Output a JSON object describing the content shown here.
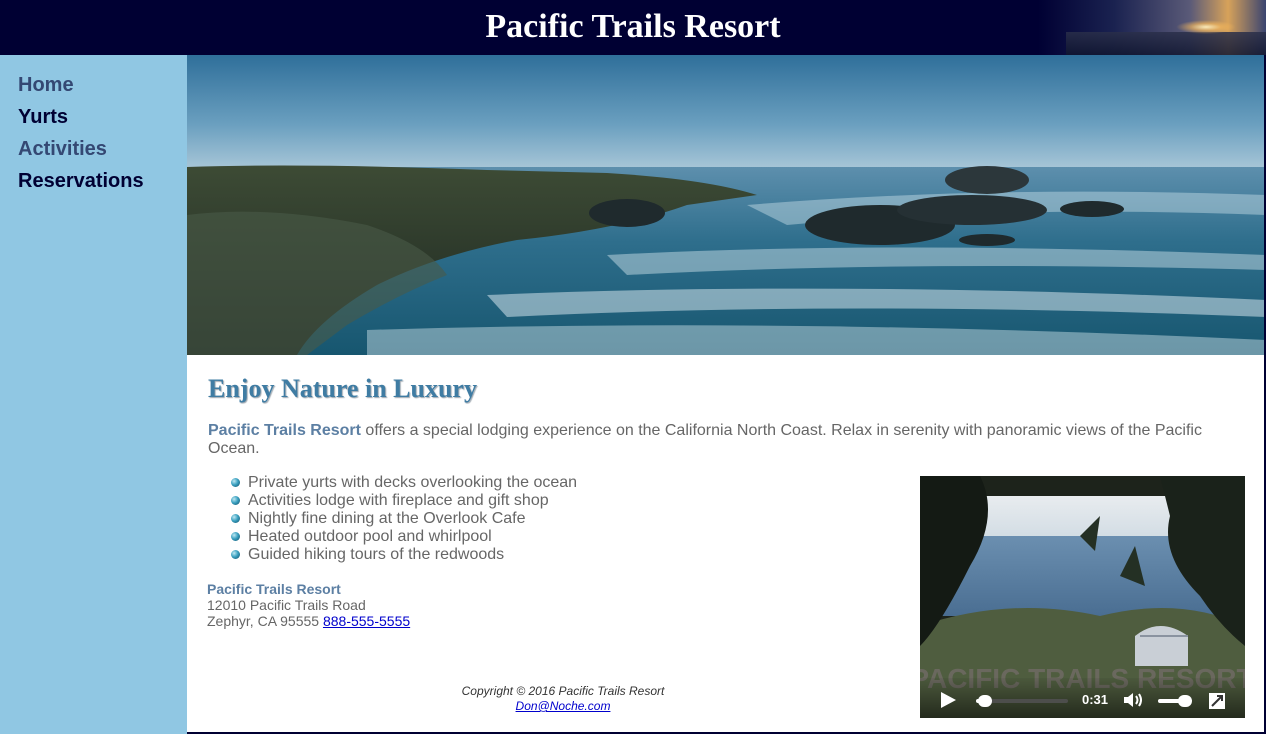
{
  "header": {
    "title": "Pacific Trails Resort"
  },
  "nav": {
    "items": [
      {
        "label": "Home",
        "state": "link"
      },
      {
        "label": "Yurts",
        "state": "visited"
      },
      {
        "label": "Activities",
        "state": "link"
      },
      {
        "label": "Reservations",
        "state": "visited"
      }
    ]
  },
  "main": {
    "heading": "Enjoy Nature in Luxury",
    "intro_name": "Pacific Trails Resort",
    "intro_text": " offers a special lodging experience on the California North Coast. Relax in serenity with panoramic views of the Pacific Ocean.",
    "features": [
      "Private yurts with decks overlooking the ocean",
      "Activities lodge with fireplace and gift shop",
      "Nightly fine dining at the Overlook Cafe",
      "Heated outdoor pool and whirlpool",
      "Guided hiking tours of the redwoods"
    ]
  },
  "address": {
    "name": "Pacific Trails Resort",
    "street": "12010 Pacific Trails Road",
    "city": "Zephyr, CA 95555",
    "phone": "888-555-5555"
  },
  "video": {
    "overlay_text": "PACIFIC TRAILS RESORT",
    "time": "0:31",
    "progress_fraction": 0.1,
    "volume_fraction": 0.85
  },
  "footer": {
    "copyright": "Copyright © 2016 Pacific Trails Resort",
    "email": "Don@Noche.com"
  },
  "colors": {
    "header_bg": "#000033",
    "sidebar_bg": "#90c7e3",
    "heading": "#3f7ca3",
    "body_text": "#666666",
    "link_nav": "#344873",
    "visited_nav": "#000033"
  }
}
